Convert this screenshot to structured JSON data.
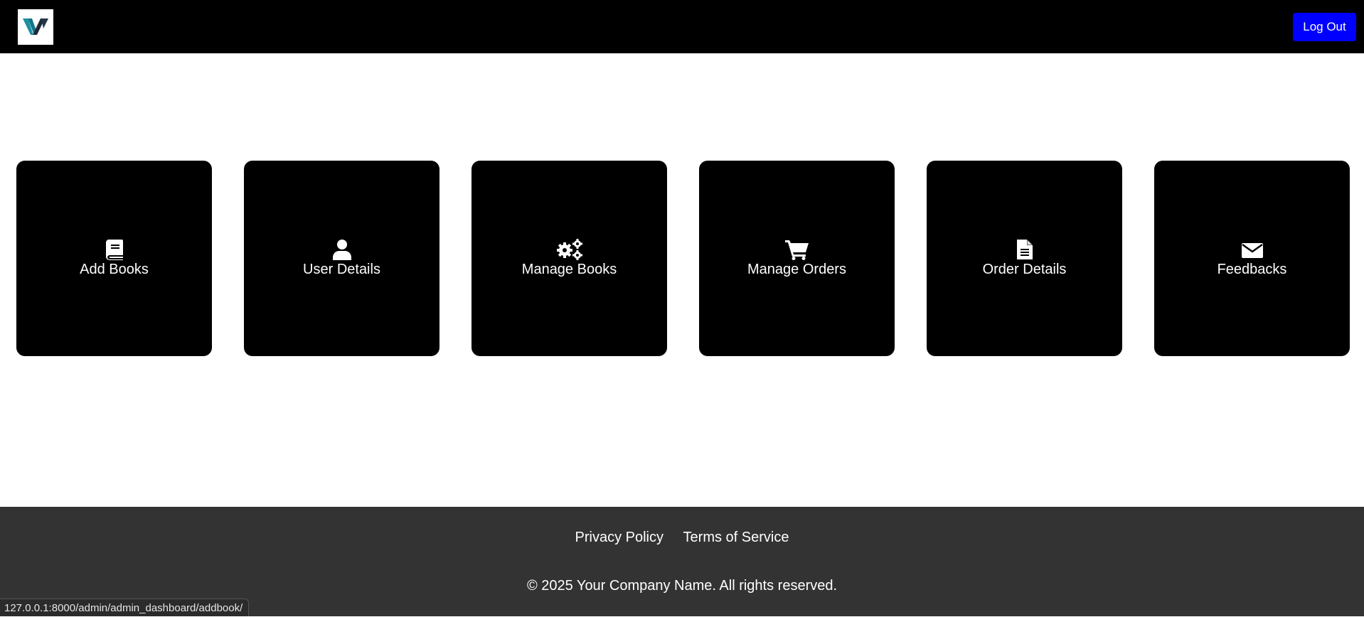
{
  "header": {
    "logo_alt": "W",
    "logout_label": "Log Out"
  },
  "cards": [
    {
      "label": "Add Books",
      "icon": "book-icon"
    },
    {
      "label": "User Details",
      "icon": "user-icon"
    },
    {
      "label": "Manage Books",
      "icon": "gears-icon"
    },
    {
      "label": "Manage Orders",
      "icon": "cart-icon"
    },
    {
      "label": "Order Details",
      "icon": "document-icon"
    },
    {
      "label": "Feedbacks",
      "icon": "envelope-icon"
    }
  ],
  "footer": {
    "privacy_label": "Privacy Policy",
    "terms_label": "Terms of Service",
    "copyright": "© 2025 Your Company Name. All rights reserved."
  },
  "status_bar": {
    "url": "127.0.0.1:8000/admin/admin_dashboard/addbook/"
  },
  "colors": {
    "header_bg": "#000000",
    "logout_bg": "#0000ff",
    "card_bg": "#000000",
    "footer_bg": "#333333",
    "logo_teal": "#1b8fa3",
    "logo_dark": "#1e2a3a"
  }
}
